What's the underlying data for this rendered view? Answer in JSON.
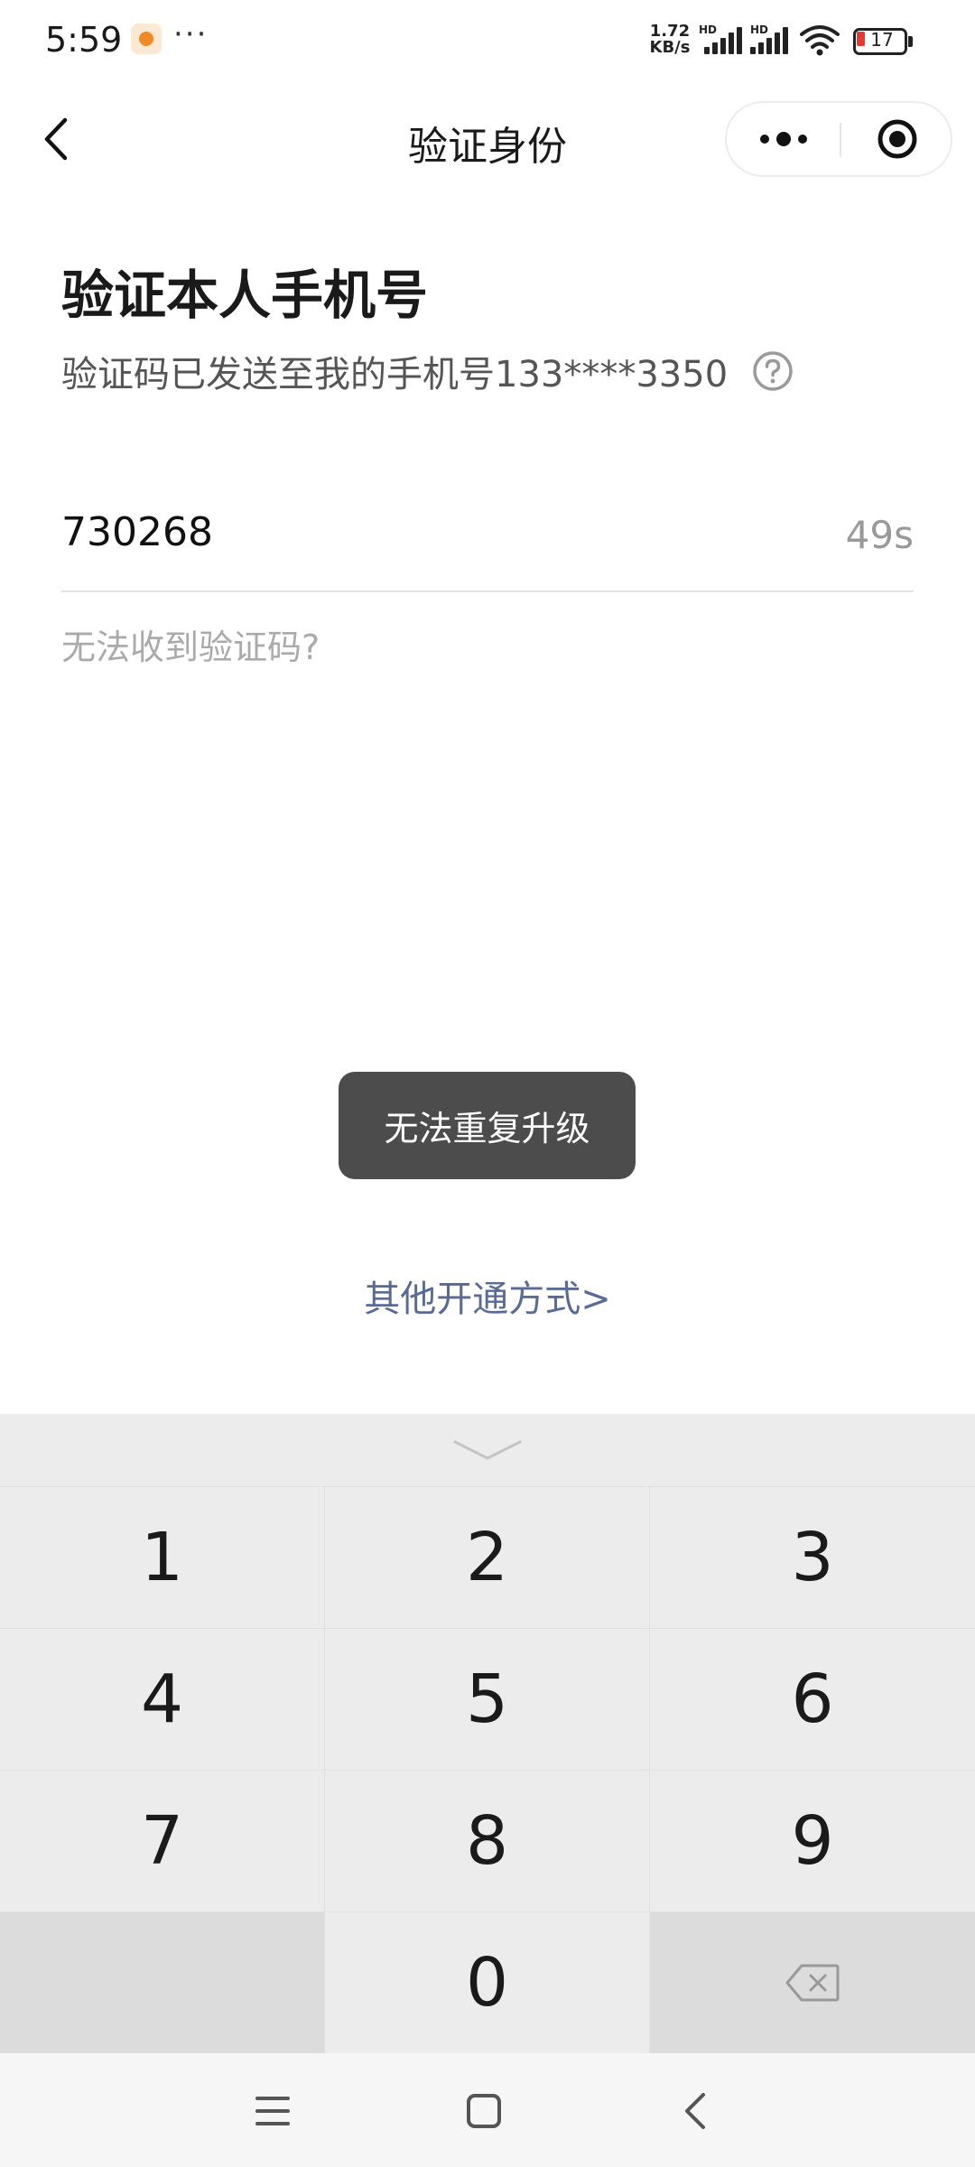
{
  "status_bar": {
    "time": "5:59",
    "more": "···",
    "net_speed_value": "1.72",
    "net_speed_unit": "KB/s",
    "signal1_label": "HD",
    "signal2_label": "HD",
    "battery_level": "17"
  },
  "nav": {
    "title": "验证身份"
  },
  "content": {
    "heading": "验证本人手机号",
    "subtitle": "验证码已发送至我的手机号133****3350",
    "code_value": "730268",
    "countdown": "49s",
    "no_code_link": "无法收到验证码?",
    "toast": "无法重复升级",
    "other_methods_link": "其他开通方式>"
  },
  "keyboard": {
    "keys": [
      "1",
      "2",
      "3",
      "4",
      "5",
      "6",
      "7",
      "8",
      "9",
      "",
      "0",
      "backspace"
    ]
  },
  "colors": {
    "link_blue": "#576b95",
    "toast_bg": "#4c4c4c",
    "battery_red": "#e53935",
    "keyboard_bg": "#ececec"
  }
}
